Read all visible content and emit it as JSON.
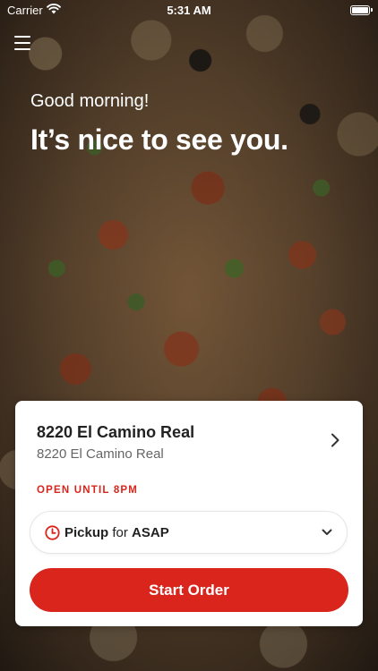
{
  "status_bar": {
    "carrier": "Carrier",
    "time": "5:31 AM"
  },
  "header": {
    "menu_icon": "hamburger-menu-icon"
  },
  "greeting": "Good morning!",
  "headline": "It’s nice to see you.",
  "location_card": {
    "location_name": "8220 El Camino Real",
    "location_address": "8220 El Camino Real",
    "open_status": "OPEN UNTIL 8PM",
    "order_type": {
      "method": "Pickup",
      "connector": "for",
      "time": "ASAP"
    },
    "start_button_label": "Start Order"
  },
  "colors": {
    "accent": "#d9251c",
    "card_bg": "#ffffff",
    "text": "#222222",
    "subtext": "#666666"
  },
  "icons": [
    "wifi-icon",
    "battery-icon",
    "hamburger-menu-icon",
    "chevron-right-icon",
    "clock-icon",
    "chevron-down-icon"
  ]
}
